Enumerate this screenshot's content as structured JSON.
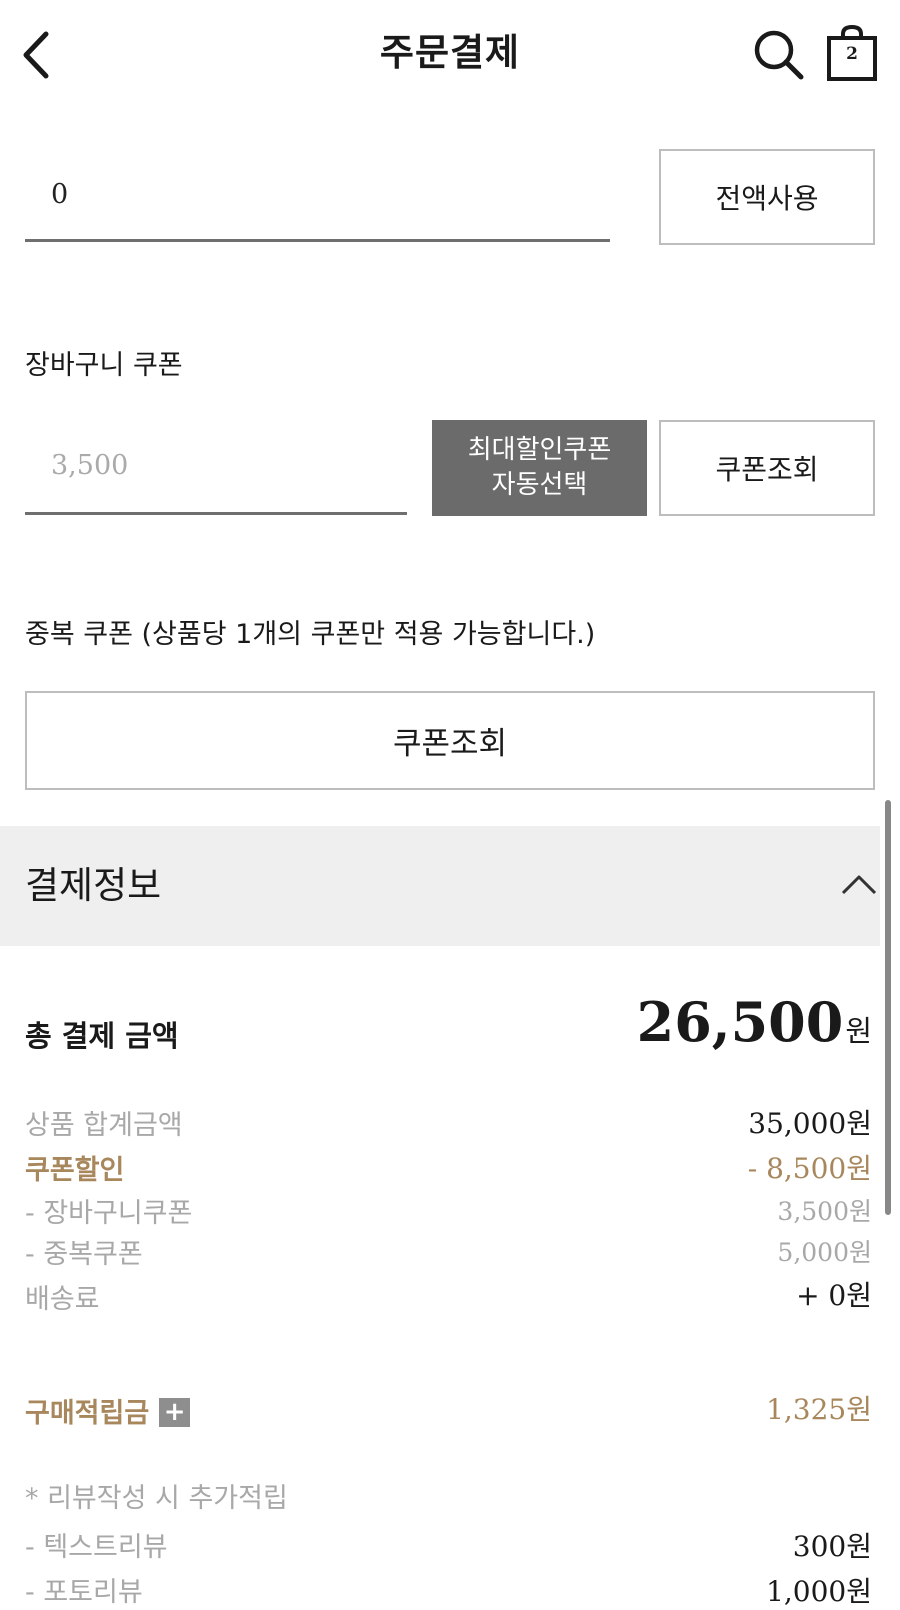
{
  "header": {
    "title": "주문결제",
    "back_icon": "chevron-left-icon",
    "search_icon": "search-icon",
    "cart_icon": "shopping-bag-icon",
    "cart_count": "2"
  },
  "points": {
    "input_value": "0",
    "use_all_label": "전액사용"
  },
  "basket_coupon": {
    "label": "장바구니 쿠폰",
    "placeholder": "3,500",
    "auto_select_line1": "최대할인쿠폰",
    "auto_select_line2": "자동선택",
    "search_label": "쿠폰조회"
  },
  "duplicate_coupon": {
    "label": "중복 쿠폰 (상품당 1개의 쿠폰만 적용 가능합니다.)",
    "search_label": "쿠폰조회"
  },
  "payment_info": {
    "title": "결제정보",
    "total_label": "총 결제 금액",
    "total_amount": "26,500",
    "unit": "원",
    "rows": [
      {
        "label": "상품 합계금액",
        "value": "35,000원"
      },
      {
        "label": "쿠폰할인",
        "value": "- 8,500원"
      },
      {
        "label": "- 장바구니쿠폰",
        "value": "3,500원"
      },
      {
        "label": "- 중복쿠폰",
        "value": "5,000원"
      },
      {
        "label": "배송료",
        "value": "+ 0원"
      }
    ],
    "reward_label": "구매적립금",
    "reward_plus": "+",
    "reward_value": "1,325원",
    "review_note": "* 리뷰작성 시 추가적립",
    "review_rows": [
      {
        "label": "- 텍스트리뷰",
        "value": "300원"
      },
      {
        "label": "- 포토리뷰",
        "value": "1,000원"
      }
    ]
  },
  "colors": {
    "accent_gold": "#a8875c",
    "button_dark": "#6b6b6b",
    "section_bg": "#efefef",
    "muted_text": "#a8a8a8"
  }
}
